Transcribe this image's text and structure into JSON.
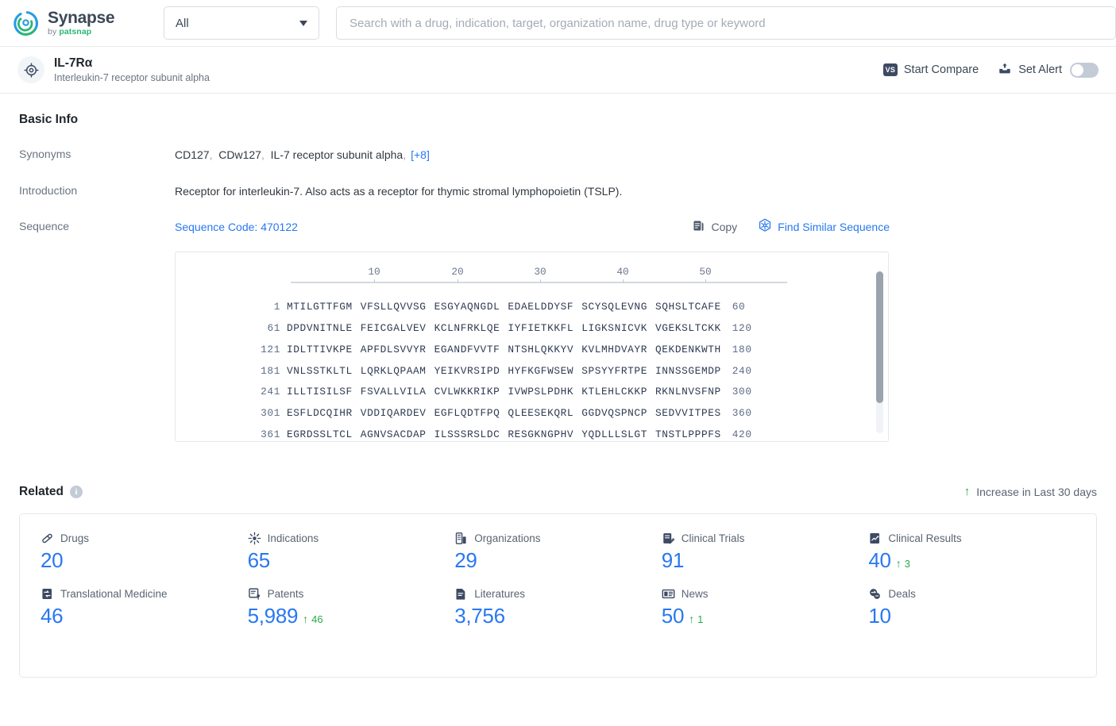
{
  "header": {
    "logo_name": "Synapse",
    "logo_by": "by ",
    "logo_brand": "patsnap",
    "scope_value": "All",
    "search_placeholder": "Search with a drug, indication, target, organization name, drug type or keyword"
  },
  "entity": {
    "title": "IL-7Rα",
    "subtitle": "Interleukin-7 receptor subunit alpha",
    "start_compare_label": "Start Compare",
    "start_compare_badge": "VS",
    "set_alert_label": "Set Alert",
    "alert_toggle_state": "off"
  },
  "basic_info": {
    "section_title": "Basic Info",
    "synonyms_label": "Synonyms",
    "synonyms": [
      "CD127",
      "CDw127",
      "IL-7 receptor subunit alpha"
    ],
    "synonyms_more": "[+8]",
    "introduction_label": "Introduction",
    "introduction_text": "Receptor for interleukin-7. Also acts as a receptor for thymic stromal lymphopoietin (TSLP).",
    "sequence_label": "Sequence",
    "sequence_code": "Sequence Code: 470122",
    "copy_label": "Copy",
    "find_similar_label": "Find Similar Sequence"
  },
  "sequence": {
    "ruler": [
      "10",
      "20",
      "30",
      "40",
      "50"
    ],
    "rows": [
      {
        "start": "1",
        "chunks": [
          "MTILGTTFGM",
          "VFSLLQVVSG",
          "ESGYAQNGDL",
          "EDAELDDYSF",
          "SCYSQLEVNG",
          "SQHSLTCAFE"
        ],
        "end": "60"
      },
      {
        "start": "61",
        "chunks": [
          "DPDVNITNLE",
          "FEICGALVEV",
          "KCLNFRKLQE",
          "IYFIETKKFL",
          "LIGKSNICVK",
          "VGEKSLTCKK"
        ],
        "end": "120"
      },
      {
        "start": "121",
        "chunks": [
          "IDLTTIVKPE",
          "APFDLSVVYR",
          "EGANDFVVTF",
          "NTSHLQKKYV",
          "KVLMHDVAYR",
          "QEKDENKWTH"
        ],
        "end": "180"
      },
      {
        "start": "181",
        "chunks": [
          "VNLSSTKLTL",
          "LQRKLQPAAM",
          "YEIKVRSIPD",
          "HYFKGFWSEW",
          "SPSYYFRTPE",
          "INNSSGEMDP"
        ],
        "end": "240"
      },
      {
        "start": "241",
        "chunks": [
          "ILLTISILSF",
          "FSVALLVILA",
          "CVLWKKRIKP",
          "IVWPSLPDHK",
          "KTLEHLCKKP",
          "RKNLNVSFNP"
        ],
        "end": "300"
      },
      {
        "start": "301",
        "chunks": [
          "ESFLDCQIHR",
          "VDDIQARDEV",
          "EGFLQDTFPQ",
          "QLEESEKQRL",
          "GGDVQSPNCP",
          "SEDVVITPES"
        ],
        "end": "360"
      },
      {
        "start": "361",
        "chunks": [
          "EGRDSSLTCL",
          "AGNVSACDAP",
          "ILSSSRSLDC",
          "RESGKNGPHV",
          "YQDLLLSLGT",
          "TNSTLPPPFS"
        ],
        "end": "420"
      }
    ]
  },
  "related": {
    "title": "Related",
    "legend_label": "Increase in Last 30 days",
    "stats": [
      {
        "icon": "pill-icon",
        "label": "Drugs",
        "value": "20",
        "delta": ""
      },
      {
        "icon": "virus-icon",
        "label": "Indications",
        "value": "65",
        "delta": ""
      },
      {
        "icon": "building-icon",
        "label": "Organizations",
        "value": "29",
        "delta": ""
      },
      {
        "icon": "clipboard-pen-icon",
        "label": "Clinical Trials",
        "value": "91",
        "delta": ""
      },
      {
        "icon": "chart-document-icon",
        "label": "Clinical Results",
        "value": "40",
        "delta": "3"
      },
      {
        "icon": "translational-icon",
        "label": "Translational Medicine",
        "value": "46",
        "delta": ""
      },
      {
        "icon": "patent-icon",
        "label": "Patents",
        "value": "5,989",
        "delta": "46"
      },
      {
        "icon": "literature-icon",
        "label": "Literatures",
        "value": "3,756",
        "delta": ""
      },
      {
        "icon": "news-icon",
        "label": "News",
        "value": "50",
        "delta": "1"
      },
      {
        "icon": "deals-icon",
        "label": "Deals",
        "value": "10",
        "delta": ""
      }
    ]
  },
  "colors": {
    "accent_blue": "#2878f0",
    "increase_green": "#2aa84a",
    "text_dark": "#1f252b",
    "text_muted": "#6a7480"
  }
}
